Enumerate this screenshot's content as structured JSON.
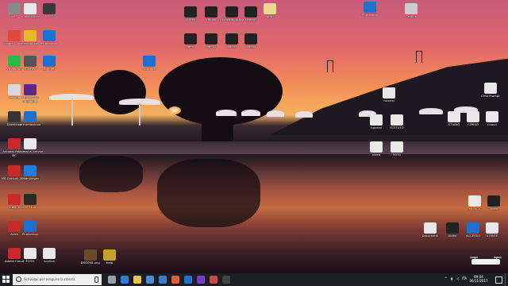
{
  "desktop": {
    "icons": [
      {
        "label": "ASS",
        "color": "#8a8a8a"
      },
      {
        "label": "impostazioni",
        "color": "#e8e8e8"
      },
      {
        "label": "DECO",
        "color": "#3a3a3a"
      },
      {
        "label": "Google Chrome",
        "color": "#e04a3a"
      },
      {
        "label": "Sincronizza",
        "color": "#e8b82a"
      },
      {
        "label": "Photoshop",
        "color": "#1f6fd0"
      },
      {
        "label": "WhatsApp",
        "color": "#2ab84a"
      },
      {
        "label": "STAMPA",
        "color": "#555555"
      },
      {
        "label": "completo",
        "color": "#1f6fd0"
      },
      {
        "label": "Cestino",
        "color": "#d8d8e0"
      },
      {
        "label": "PROGETTO PREMIERE",
        "color": "#5a2a8a"
      },
      {
        "label": "Download",
        "color": "#333333"
      },
      {
        "label": "presentazione",
        "color": "#1f6fd0"
      },
      {
        "label": "Acrobat Reader DC",
        "color": "#c82a2a"
      },
      {
        "label": "Accessi ai servizi",
        "color": "#e8e8e8"
      },
      {
        "label": "MS Outlook 2016",
        "color": "#c82a2a"
      },
      {
        "label": "TeamViewer",
        "color": "#1f7fe0"
      },
      {
        "label": "CCleaner",
        "color": "#c82a2a"
      },
      {
        "label": "OBS Studio",
        "color": "#2a2a2a"
      },
      {
        "label": "Avira",
        "color": "#c82a2a"
      },
      {
        "label": "Photoshop",
        "color": "#1f6fd0"
      },
      {
        "label": "Adobe Cloud",
        "color": "#c82a2a"
      },
      {
        "label": "FOTO",
        "color": "#e8e8e8"
      },
      {
        "label": "scarica",
        "color": "#e8e8e8"
      },
      {
        "label": "DSC098.png",
        "color": "#6a4a2a"
      },
      {
        "label": "Help",
        "color": "#c8a02a"
      },
      {
        "label": "screen",
        "color": "#222222"
      },
      {
        "label": "sfondo",
        "color": "#222222"
      },
      {
        "label": "cinematografica",
        "color": "#222222"
      },
      {
        "label": "screen3",
        "color": "#222222"
      },
      {
        "label": "word",
        "color": "#e8d890"
      },
      {
        "label": "video1",
        "color": "#222222"
      },
      {
        "label": "video2",
        "color": "#222222"
      },
      {
        "label": "video3",
        "color": "#222222"
      },
      {
        "label": "video4",
        "color": "#222222"
      },
      {
        "label": "Photoshop",
        "color": "#1f6fd0"
      },
      {
        "label": "Cestino",
        "color": "#cccccc"
      },
      {
        "label": "youtube",
        "color": "#1f6fd0"
      },
      {
        "label": "tutorial",
        "color": "#e8e8e8"
      },
      {
        "label": "Cmd Prompt",
        "color": "#e8e8e8"
      },
      {
        "label": "tutorial",
        "color": "#e8e8e8"
      },
      {
        "label": "ISTITUTO",
        "color": "#e8e8e8"
      },
      {
        "label": "STUDIO",
        "color": "#e8e8e8"
      },
      {
        "label": "CORSO",
        "color": "#e8e8e8"
      },
      {
        "label": "nuovo",
        "color": "#e8e8e8"
      },
      {
        "label": "video",
        "color": "#e8e8e8"
      },
      {
        "label": "FOTO",
        "color": "#e8e8e8"
      },
      {
        "label": "MUSICA",
        "color": "#e8e8e8"
      },
      {
        "label": "video",
        "color": "#222222"
      },
      {
        "label": "Documenti",
        "color": "#e8e8e8"
      },
      {
        "label": "Video",
        "color": "#222222"
      },
      {
        "label": "ACCESSO",
        "color": "#1f6fd0"
      },
      {
        "label": "UTENTE",
        "color": "#e8e8e8"
      }
    ]
  },
  "taskbar": {
    "search_placeholder": "Scrivi qui per eseguire la ricerca",
    "apps": [
      {
        "name": "task-view",
        "color": "#9aa0aa"
      },
      {
        "name": "edge",
        "color": "#2a7fd4"
      },
      {
        "name": "file-explorer",
        "color": "#e8c24a"
      },
      {
        "name": "store",
        "color": "#4a8ad4"
      },
      {
        "name": "mail",
        "color": "#3a7ad0"
      },
      {
        "name": "chrome",
        "color": "#e05a3a"
      },
      {
        "name": "photoshop",
        "color": "#1f6fd0"
      },
      {
        "name": "premiere",
        "color": "#7a3ad0"
      },
      {
        "name": "media",
        "color": "#c84a4a"
      },
      {
        "name": "obs",
        "color": "#444444"
      }
    ],
    "clock_time": "09:04",
    "clock_date": "06/11/2017",
    "tray_lang": "ITA"
  }
}
